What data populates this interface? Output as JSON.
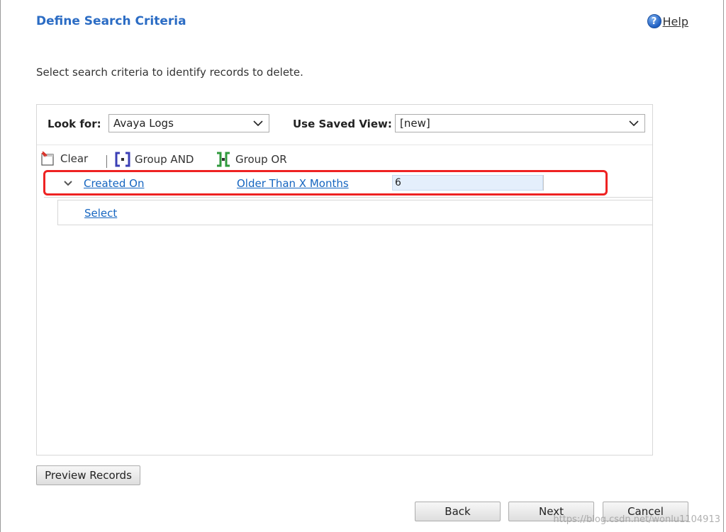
{
  "dialog": {
    "title": "Define Search Criteria",
    "help_label": "Help",
    "help_icon_glyph": "?",
    "instructions": "Select search criteria to identify records to delete."
  },
  "criteria_panel": {
    "look_for_label": "Look for:",
    "look_for_value": "Avaya Logs",
    "saved_view_label": "Use Saved View:",
    "saved_view_value": "[new]",
    "toolbar": {
      "clear_label": "Clear",
      "group_and_label": "Group AND",
      "group_or_label": "Group OR"
    },
    "condition": {
      "field": "Created On",
      "operator": "Older Than X Months",
      "value": "6"
    },
    "select_link": "Select"
  },
  "buttons": {
    "preview_records": "Preview Records",
    "back": "Back",
    "next": "Next",
    "cancel": "Cancel"
  },
  "watermark": "https://blog.csdn.net/wonlu1104913",
  "colors": {
    "title_blue": "#2b6cc4",
    "link_blue": "#1565c0",
    "highlight_red": "#ee2222",
    "input_bg": "#e4effc"
  }
}
